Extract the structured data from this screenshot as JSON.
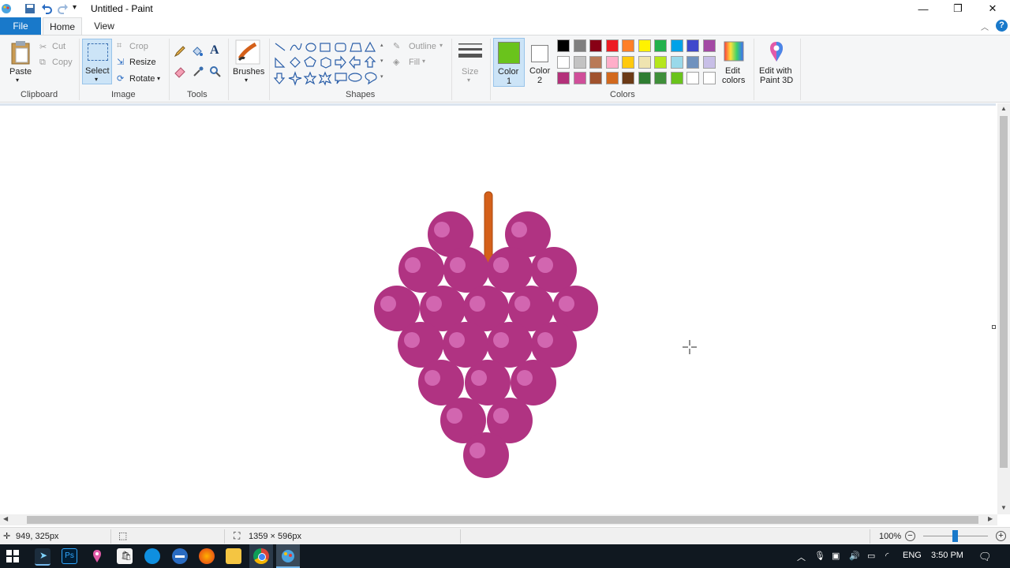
{
  "window": {
    "title": "Untitled - Paint"
  },
  "tabs": {
    "file": "File",
    "home": "Home",
    "view": "View"
  },
  "clipboard": {
    "paste": "Paste",
    "cut": "Cut",
    "copy": "Copy",
    "group": "Clipboard"
  },
  "image": {
    "select": "Select",
    "crop": "Crop",
    "resize": "Resize",
    "rotate": "Rotate",
    "group": "Image"
  },
  "tools": {
    "group": "Tools",
    "text_tool": "A"
  },
  "brushes": {
    "label": "Brushes"
  },
  "shapes": {
    "group": "Shapes",
    "outline": "Outline",
    "fill": "Fill"
  },
  "size": {
    "label": "Size"
  },
  "colors": {
    "group": "Colors",
    "color1_label": "Color",
    "color1_num": "1",
    "color2_label": "Color",
    "color2_num": "2",
    "color1": "#6ac31c",
    "color2": "#ffffff",
    "edit_colors_1": "Edit",
    "edit_colors_2": "colors",
    "paint3d_1": "Edit with",
    "paint3d_2": "Paint 3D",
    "palette_row1": [
      "#000000",
      "#7f7f7f",
      "#880015",
      "#ed1c24",
      "#ff7f27",
      "#fff200",
      "#22b14c",
      "#00a2e8",
      "#3f48cc",
      "#a349a4"
    ],
    "palette_row2": [
      "#ffffff",
      "#c3c3c3",
      "#b97a57",
      "#ffaec9",
      "#ffc90e",
      "#efe4b0",
      "#b5e61d",
      "#99d9ea",
      "#7092be",
      "#c8bfe7"
    ],
    "palette_row3": [
      "#b3317a",
      "#d04f9a",
      "#a0522d",
      "#d2691e",
      "#6b3a16",
      "#2e7d32",
      "#3f8f3a",
      "#6ac31c",
      "#ffffff",
      "#ffffff"
    ]
  },
  "artwork": {
    "grape_color": "#b03382",
    "highlight_color": "#d266b0",
    "stem_color": "#d4601a"
  },
  "status": {
    "cursor_pos": "949, 325px",
    "canvas_size": "1359 × 596px",
    "zoom": "100%"
  },
  "taskbar": {
    "lang": "ENG",
    "time": "3:50 PM"
  }
}
